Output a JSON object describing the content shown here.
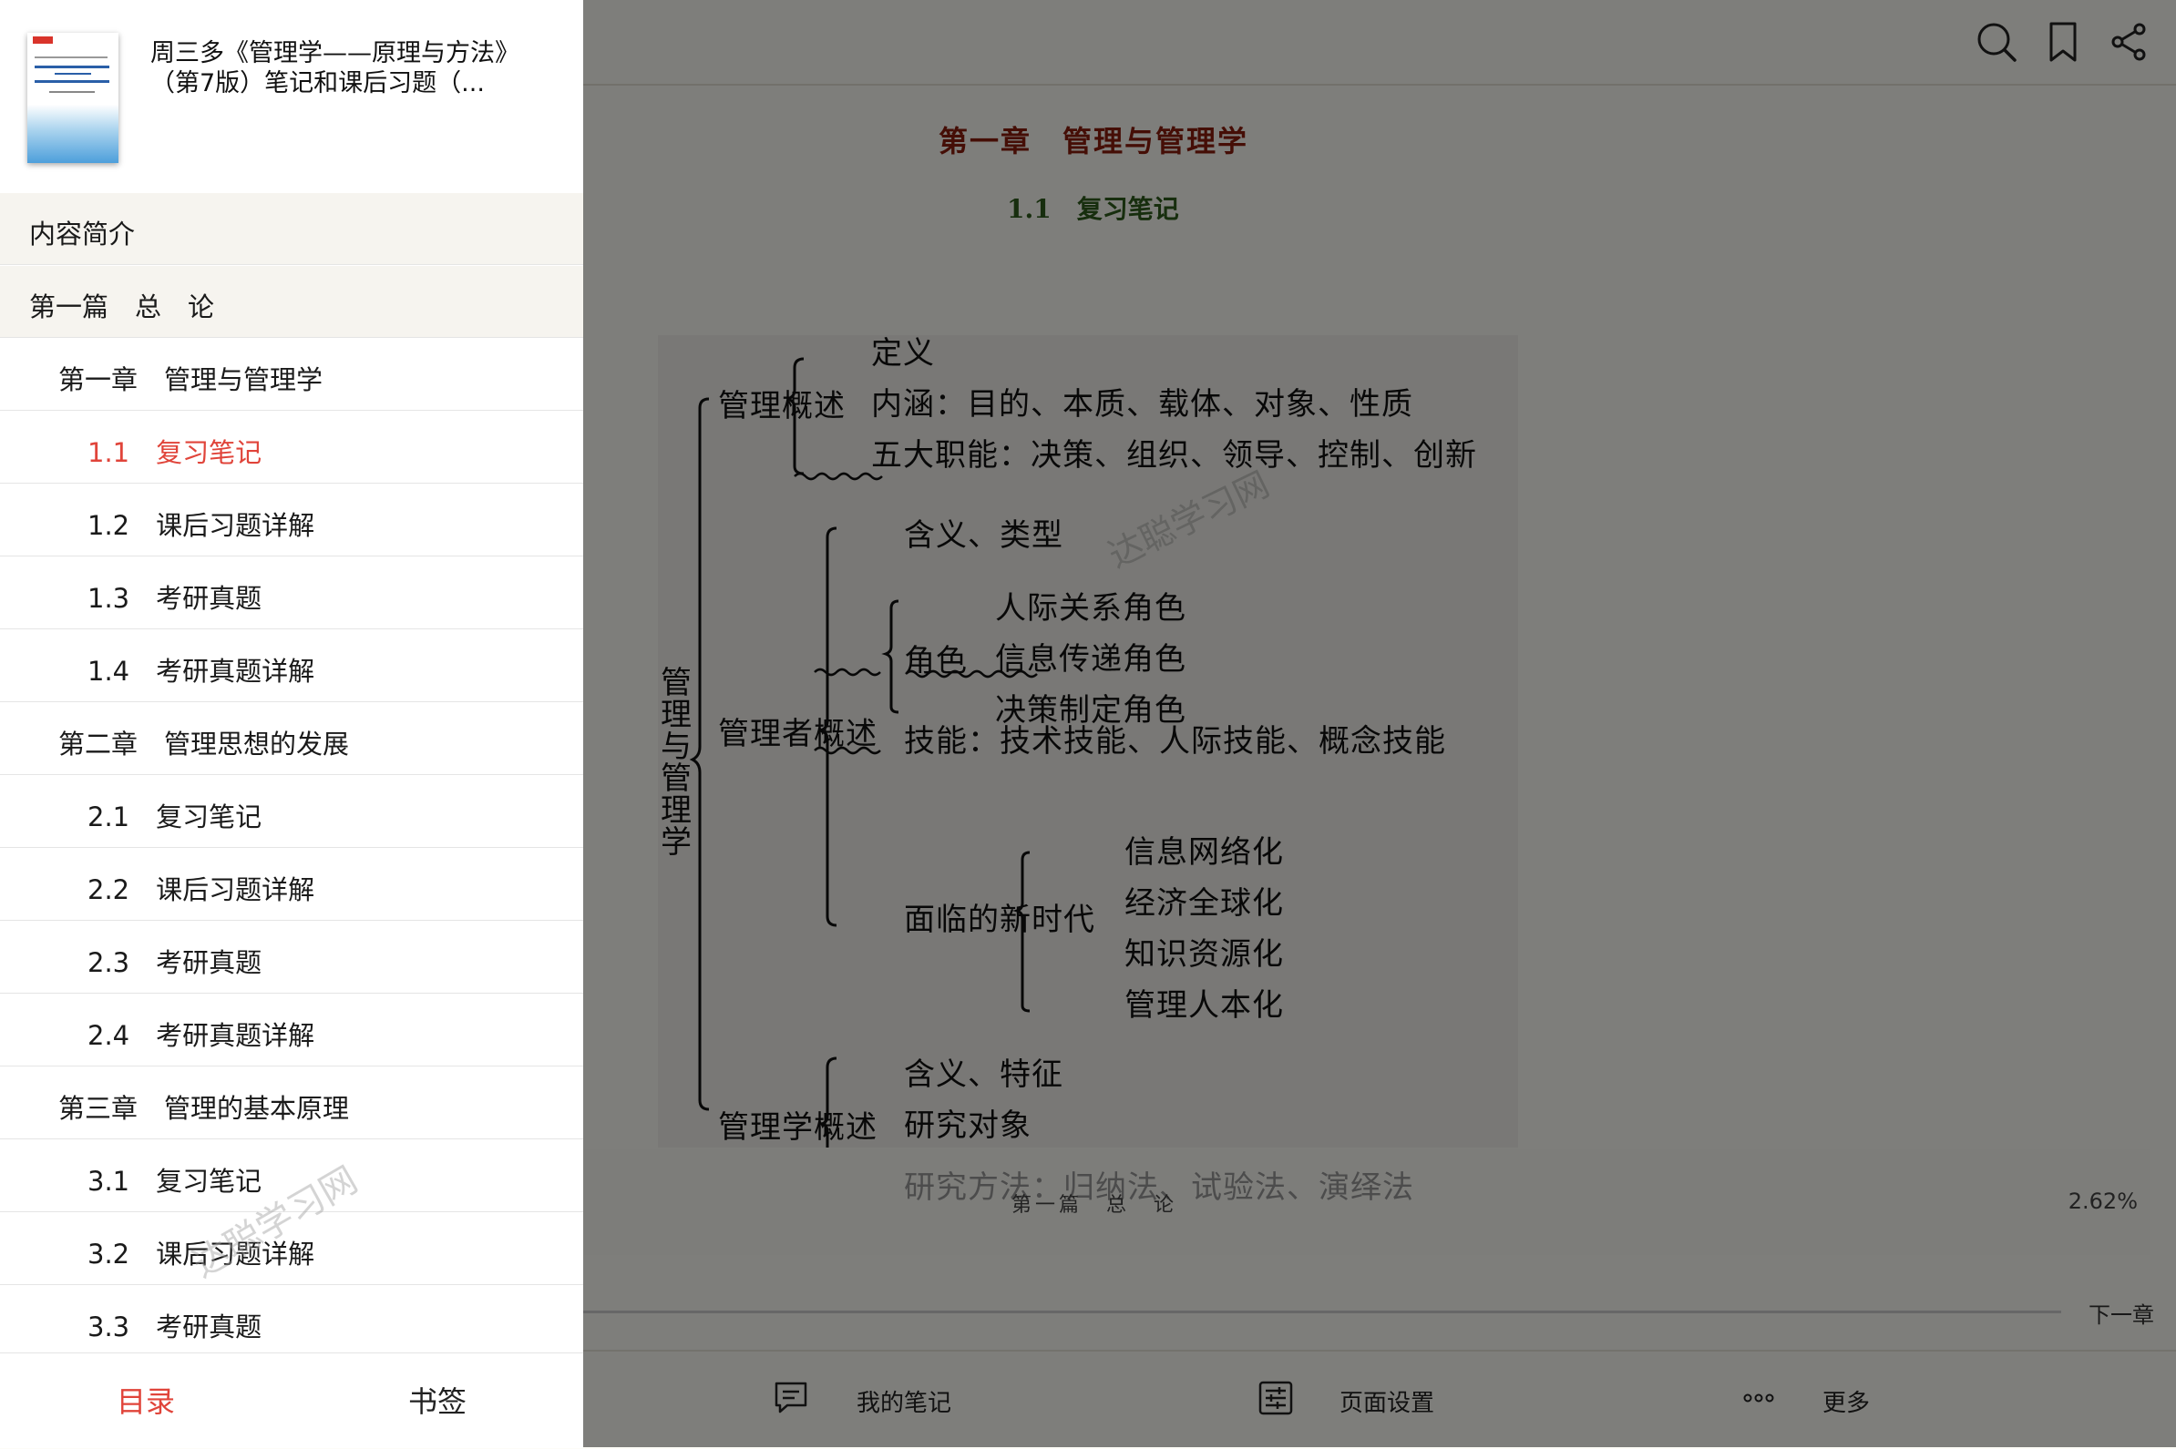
{
  "book": {
    "title_line1": "周三多《管理学——原理与方法》",
    "title_line2": "（第7版）笔记和课后习题（..."
  },
  "toc": [
    {
      "label": "内容简介",
      "level": 0,
      "active": false
    },
    {
      "label": "第一篇　总　论",
      "level": 0,
      "active": false
    },
    {
      "label": "第一章　管理与管理学",
      "level": 1,
      "active": false
    },
    {
      "label": "1.1　复习笔记",
      "level": 2,
      "active": true
    },
    {
      "label": "1.2　课后习题详解",
      "level": 2,
      "active": false
    },
    {
      "label": "1.3　考研真题",
      "level": 2,
      "active": false
    },
    {
      "label": "1.4　考研真题详解",
      "level": 2,
      "active": false
    },
    {
      "label": "第二章　管理思想的发展",
      "level": 1,
      "active": false
    },
    {
      "label": "2.1　复习笔记",
      "level": 2,
      "active": false
    },
    {
      "label": "2.2　课后习题详解",
      "level": 2,
      "active": false
    },
    {
      "label": "2.3　考研真题",
      "level": 2,
      "active": false
    },
    {
      "label": "2.4　考研真题详解",
      "level": 2,
      "active": false
    },
    {
      "label": "第三章　管理的基本原理",
      "level": 1,
      "active": false
    },
    {
      "label": "3.1　复习笔记",
      "level": 2,
      "active": false
    },
    {
      "label": "3.2　课后习题详解",
      "level": 2,
      "active": false
    },
    {
      "label": "3.3　考研真题",
      "level": 2,
      "active": false
    }
  ],
  "tabs": {
    "contents": "目录",
    "bookmarks": "书签"
  },
  "reader": {
    "chapter_title": "第一章　管理与管理学",
    "section_title": "1.1　复习笔记",
    "footer_part": "第一篇　总　论",
    "progress": "2.62%",
    "next_chapter": "下一章",
    "watermark": "达聪学习网"
  },
  "mindmap": {
    "root": "管理与管理学",
    "b1": "管理概述",
    "b1_items": [
      "定义",
      "内涵：目的、本质、载体、对象、性质",
      "五大职能：决策、组织、领导、控制、创新"
    ],
    "b2": "管理者概述",
    "b2_meaning": "含义、类型",
    "roles_label": "角色",
    "roles": [
      "人际关系角色",
      "信息传递角色",
      "决策制定角色"
    ],
    "skills": "技能：技术技能、人际技能、概念技能",
    "era_label": "面临的新时代",
    "era": [
      "信息网络化",
      "经济全球化",
      "知识资源化",
      "管理人本化"
    ],
    "b3": "管理学概述",
    "b3_items": [
      "含义、特征",
      "研究对象",
      "研究方法：归纳法、试验法、演绎法"
    ]
  },
  "bottom_bar": {
    "notes": "我的笔记",
    "page_settings": "页面设置",
    "more": "更多"
  },
  "icons": {
    "search": "search-icon",
    "bookmark": "bookmark-icon",
    "share": "share-icon",
    "note": "note-icon",
    "settings": "sliders-icon",
    "more": "more-dots-icon"
  },
  "colors": {
    "accent": "#e0443a",
    "chapter_title": "#8a1d0d",
    "section_title": "#2f5d1c"
  }
}
